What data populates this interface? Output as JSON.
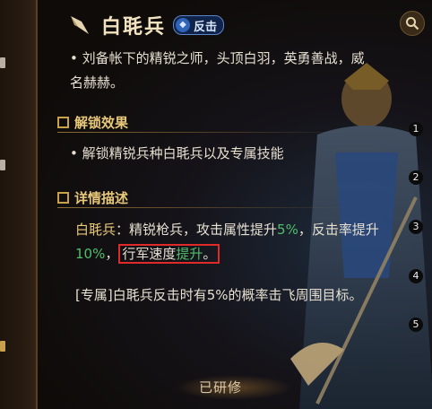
{
  "title": "白毦兵",
  "badge": {
    "label": "反击",
    "icon": "shield-badge-icon"
  },
  "intro": {
    "bullet": "•",
    "text": "刘备帐下的精锐之师，头顶白羽，英勇善战，威名赫赫。"
  },
  "unlock": {
    "heading": "解锁效果",
    "bullet": "•",
    "text": "解锁精锐兵种白毦兵以及专属技能"
  },
  "details": {
    "heading": "详情描述",
    "name": "白毦兵",
    "line_part1": "：精锐枪兵，攻击属性提升",
    "pct1": "5%",
    "line_part2": "，反击率提升",
    "pct2": "10%",
    "comma": "，",
    "highlight_prefix": "行军速度",
    "highlight_green": "提升",
    "period": "。"
  },
  "exclusive": {
    "text": "[专属]白毦兵反击时有5%的概率击飞周围目标。"
  },
  "markers": [
    "1",
    "2",
    "3",
    "4",
    "5"
  ],
  "status": {
    "label": "已研修"
  },
  "colors": {
    "accent_gold": "#e8c879",
    "green": "#4fbf6a",
    "highlight_border": "#e02a2a",
    "badge_blue": "#2f64b8"
  }
}
